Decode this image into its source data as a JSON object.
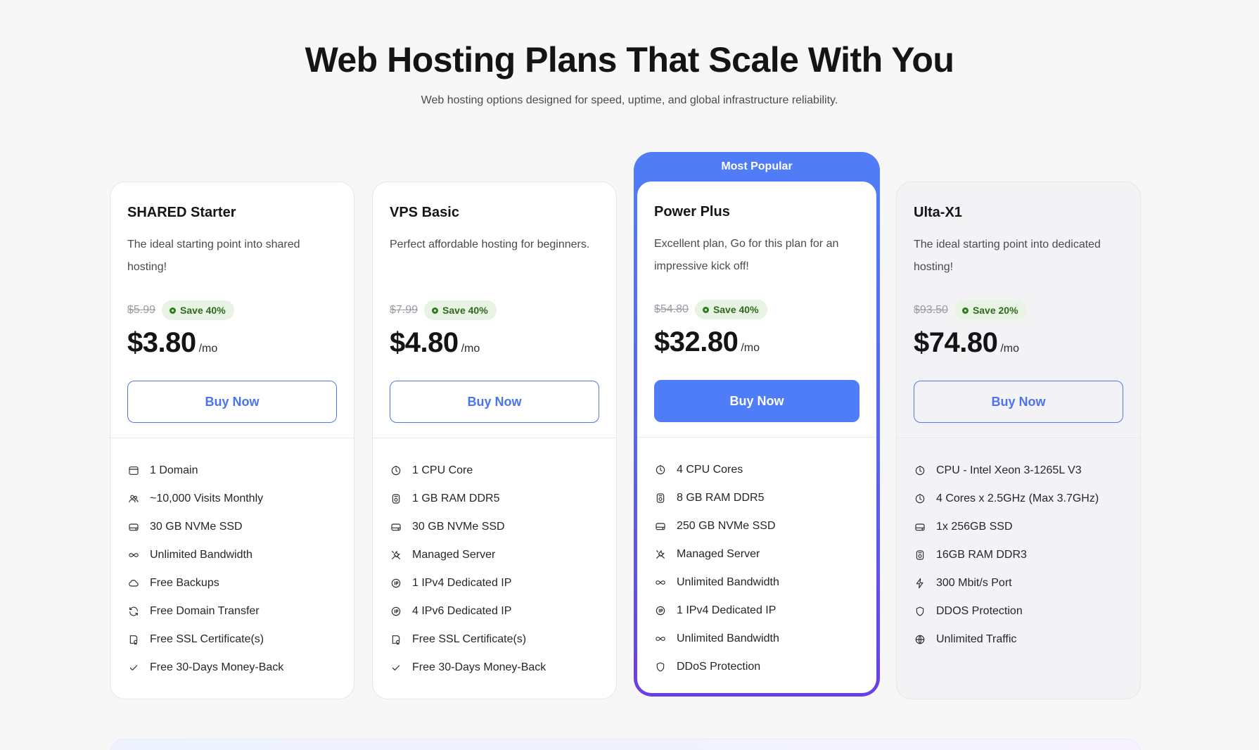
{
  "header": {
    "title": "Web Hosting Plans That Scale With You",
    "subtitle": "Web hosting options designed for speed, uptime, and global infrastructure reliability."
  },
  "colors": {
    "accent": "#4f7df7",
    "accent_gradient_end": "#6a3ee6",
    "save_badge_bg": "#e8f3e3",
    "save_badge_text": "#2d6a1e"
  },
  "plans": [
    {
      "name": "SHARED Starter",
      "description": "The ideal starting point into shared hosting!",
      "old_price": "$5.99",
      "save": "Save 40%",
      "price": "$3.80",
      "period": "/mo",
      "button": "Buy Now",
      "features": [
        {
          "icon": "browser-icon",
          "label": "1 Domain"
        },
        {
          "icon": "users-icon",
          "label": "~10,000 Visits Monthly"
        },
        {
          "icon": "hard-drive-icon",
          "label": "30 GB NVMe SSD"
        },
        {
          "icon": "infinity-icon",
          "label": "Unlimited Bandwidth"
        },
        {
          "icon": "cloud-icon",
          "label": "Free Backups"
        },
        {
          "icon": "refresh-icon",
          "label": "Free Domain Transfer"
        },
        {
          "icon": "certificate-icon",
          "label": "Free SSL Certificate(s)"
        },
        {
          "icon": "check-icon",
          "label": "Free 30-Days Money-Back"
        }
      ]
    },
    {
      "name": "VPS Basic",
      "description": "Perfect affordable hosting for beginners.",
      "old_price": "$7.99",
      "save": "Save 40%",
      "price": "$4.80",
      "period": "/mo",
      "button": "Buy Now",
      "features": [
        {
          "icon": "cpu-gauge-icon",
          "label": "1 CPU Core"
        },
        {
          "icon": "ram-icon",
          "label": "1 GB RAM DDR5"
        },
        {
          "icon": "hard-drive-icon",
          "label": "30 GB NVMe SSD"
        },
        {
          "icon": "tools-icon",
          "label": "Managed Server"
        },
        {
          "icon": "ip-icon",
          "label": "1 IPv4 Dedicated IP"
        },
        {
          "icon": "ip-icon",
          "label": "4 IPv6 Dedicated IP"
        },
        {
          "icon": "certificate-icon",
          "label": "Free SSL Certificate(s)"
        },
        {
          "icon": "check-icon",
          "label": "Free 30-Days Money-Back"
        }
      ]
    },
    {
      "name": "Power Plus",
      "badge": "Most Popular",
      "description": "Excellent plan, Go for this plan for an impressive kick off!",
      "old_price": "$54.80",
      "save": "Save 40%",
      "price": "$32.80",
      "period": "/mo",
      "button": "Buy Now",
      "features": [
        {
          "icon": "cpu-gauge-icon",
          "label": "4 CPU Cores"
        },
        {
          "icon": "ram-icon",
          "label": "8 GB RAM DDR5"
        },
        {
          "icon": "hard-drive-icon",
          "label": "250 GB NVMe SSD"
        },
        {
          "icon": "tools-icon",
          "label": "Managed Server"
        },
        {
          "icon": "infinity-icon",
          "label": "Unlimited Bandwidth"
        },
        {
          "icon": "ip-icon",
          "label": "1 IPv4 Dedicated IP"
        },
        {
          "icon": "infinity-icon",
          "label": "Unlimited Bandwidth"
        },
        {
          "icon": "shield-icon",
          "label": "DDoS Protection"
        }
      ]
    },
    {
      "name": "Ulta-X1",
      "description": "The ideal starting point into dedicated hosting!",
      "old_price": "$93.50",
      "save": "Save 20%",
      "price": "$74.80",
      "period": "/mo",
      "button": "Buy Now",
      "features": [
        {
          "icon": "cpu-gauge-icon",
          "label": "CPU - Intel Xeon 3-1265L V3"
        },
        {
          "icon": "cpu-gauge-icon",
          "label": "4 Cores x 2.5GHz (Max 3.7GHz)"
        },
        {
          "icon": "hard-drive-icon",
          "label": "1x 256GB SSD"
        },
        {
          "icon": "ram-icon",
          "label": "16GB RAM DDR3"
        },
        {
          "icon": "bolt-icon",
          "label": "300 Mbit/s Port"
        },
        {
          "icon": "shield-icon",
          "label": "DDOS Protection"
        },
        {
          "icon": "globe-icon",
          "label": "Unlimited Traffic"
        }
      ]
    }
  ]
}
